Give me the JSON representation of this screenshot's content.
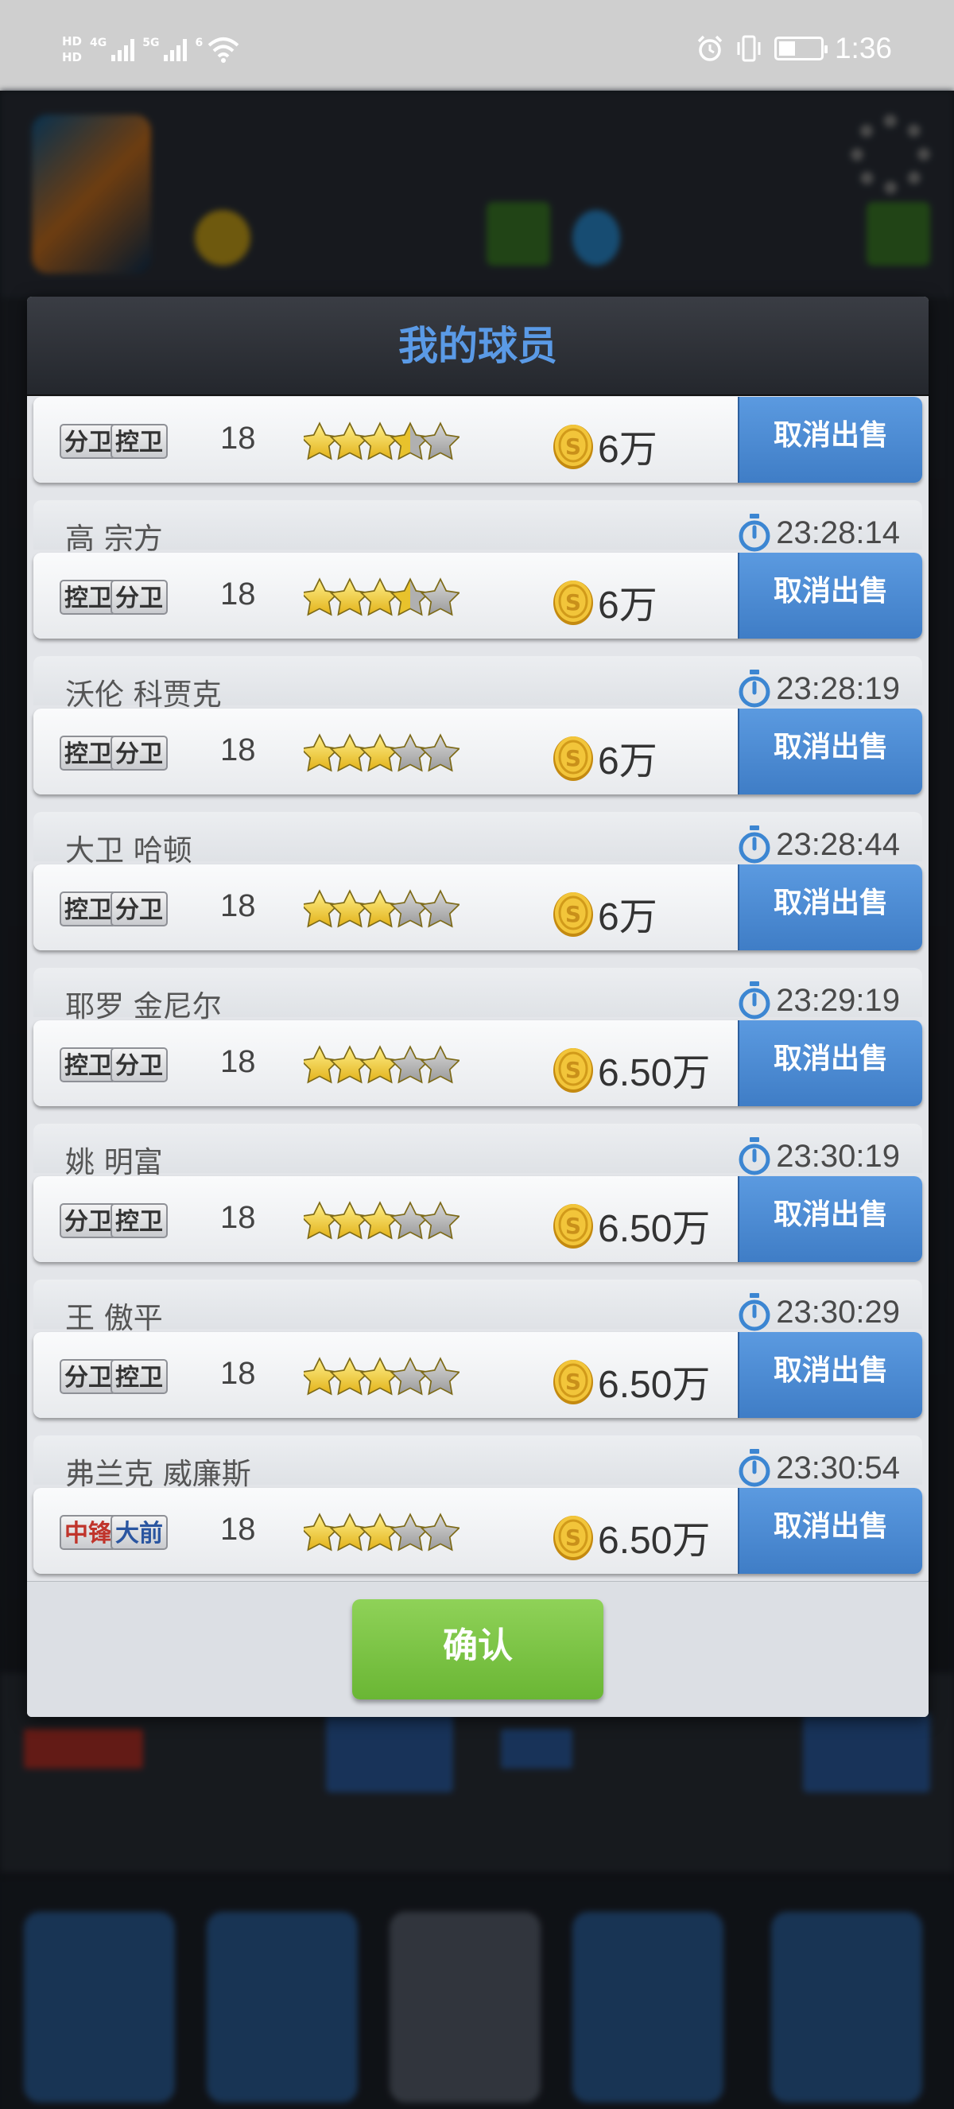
{
  "status_bar": {
    "hd_top": "HD",
    "hd_bottom": "HD",
    "network_1": "4G",
    "network_2": "5G",
    "wifi_tag": "6",
    "time": "1:36"
  },
  "dialog": {
    "title": "我的球员",
    "confirm_label": "确认",
    "cancel_sale_label": "取消出售",
    "rows": [
      {
        "name": "",
        "time": "",
        "pos1": "分卫",
        "pos2": "控卫",
        "age": "18",
        "stars": 3.5,
        "price": "6万"
      },
      {
        "name": "高 宗方",
        "time": "23:28:14",
        "pos1": "控卫",
        "pos2": "分卫",
        "age": "18",
        "stars": 3.5,
        "price": "6万"
      },
      {
        "name": "沃伦 科贾克",
        "time": "23:28:19",
        "pos1": "控卫",
        "pos2": "分卫",
        "age": "18",
        "stars": 3,
        "price": "6万"
      },
      {
        "name": "大卫 哈顿",
        "time": "23:28:44",
        "pos1": "控卫",
        "pos2": "分卫",
        "age": "18",
        "stars": 3,
        "price": "6万"
      },
      {
        "name": "耶罗 金尼尔",
        "time": "23:29:19",
        "pos1": "控卫",
        "pos2": "分卫",
        "age": "18",
        "stars": 3,
        "price": "6.50万"
      },
      {
        "name": "姚 明富",
        "time": "23:30:19",
        "pos1": "分卫",
        "pos2": "控卫",
        "age": "18",
        "stars": 3,
        "price": "6.50万"
      },
      {
        "name": "王 傲平",
        "time": "23:30:29",
        "pos1": "分卫",
        "pos2": "控卫",
        "age": "18",
        "stars": 3,
        "price": "6.50万"
      },
      {
        "name": "弗兰克 威廉斯",
        "time": "23:30:54",
        "pos1": "中锋",
        "pos2": "大前",
        "age": "18",
        "stars": 3,
        "price": "6.50万"
      }
    ]
  },
  "colors": {
    "title_blue": "#5a9ae6",
    "cancel_button_blue": "#4a8ad6",
    "confirm_green": "#7cc444",
    "coin_gold": "#e0b42a",
    "star_gold": "#f0c832"
  },
  "icons": {
    "timer": "stopwatch-icon",
    "coin": "coin-icon",
    "star": "star-icon"
  }
}
